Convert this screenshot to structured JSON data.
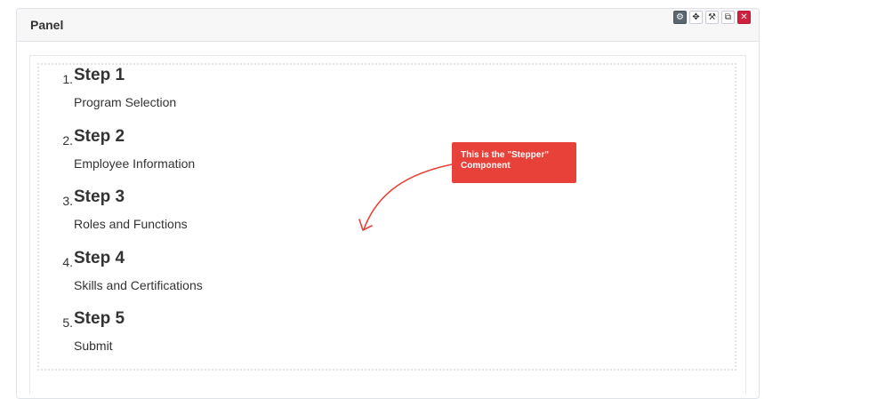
{
  "panel": {
    "title": "Panel"
  },
  "toolbar": [
    {
      "name": "settings-button",
      "icon": "gear-icon",
      "glyph": "⚙"
    },
    {
      "name": "move-button",
      "icon": "move-icon",
      "glyph": "✥"
    },
    {
      "name": "edit-button",
      "icon": "wrench-icon",
      "glyph": "⚒"
    },
    {
      "name": "copy-button",
      "icon": "copy-icon",
      "glyph": "⧉"
    },
    {
      "name": "close-button",
      "icon": "close-icon",
      "glyph": "✕"
    }
  ],
  "steps": [
    {
      "number": "1.",
      "title": "Step 1",
      "subtitle": "Program Selection"
    },
    {
      "number": "2.",
      "title": "Step 2",
      "subtitle": "Employee Information"
    },
    {
      "number": "3.",
      "title": "Step 3",
      "subtitle": "Roles and Functions"
    },
    {
      "number": "4.",
      "title": "Step 4",
      "subtitle": "Skills and Certifications"
    },
    {
      "number": "5.",
      "title": "Step 5",
      "subtitle": "Submit"
    }
  ],
  "callout": {
    "line1": "This is the \"Stepper\"",
    "line2": "Component"
  },
  "colors": {
    "callout": "#e8413a",
    "close": "#d0213f",
    "settings": "#5b6770"
  }
}
